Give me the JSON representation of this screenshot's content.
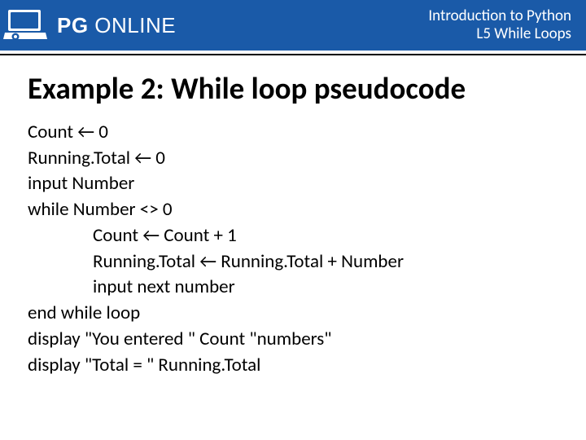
{
  "header": {
    "brand_prefix": "PG",
    "brand_suffix": " ONLINE",
    "title_line1": "Introduction to Python",
    "title_line2": "L5 While Loops"
  },
  "slide": {
    "title": "Example 2: While loop pseudocode",
    "code": {
      "l1": "Count ← 0",
      "l2": "Running.Total ← 0",
      "l3": "input Number",
      "l4": "while Number <> 0",
      "l5": "Count ← Count + 1",
      "l6": "Running.Total ← Running.Total + Number",
      "l7": "input next number",
      "l8": "end while loop",
      "l9": "display \"You entered \" Count \"numbers\"",
      "l10": "display \"Total = \" Running.Total"
    }
  }
}
